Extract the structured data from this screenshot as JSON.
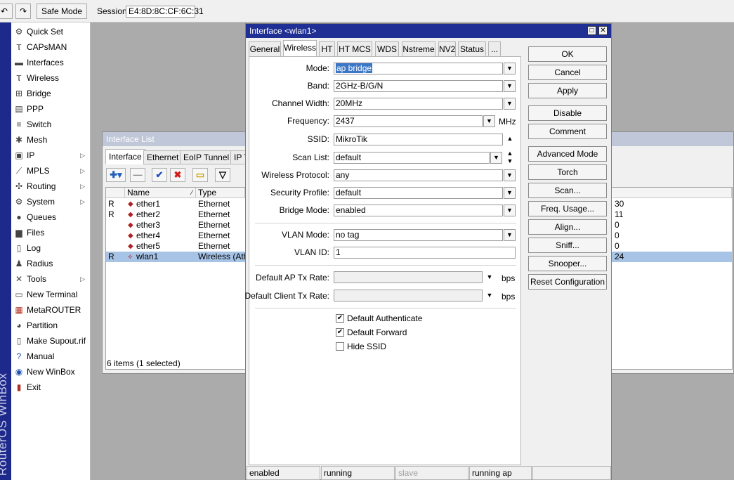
{
  "toolbar": {
    "undo_icon": "undo-icon",
    "redo_icon": "redo-icon",
    "safe_mode": "Safe Mode",
    "session_label": "Session:",
    "session_value": "E4:8D:8C:CF:6C:31"
  },
  "brand": "RouterOS WinBox",
  "sidebar": {
    "items": [
      {
        "label": "Quick Set",
        "icon": "quickset-icon",
        "submenu": false
      },
      {
        "label": "CAPsMAN",
        "icon": "antenna-icon",
        "submenu": false
      },
      {
        "label": "Interfaces",
        "icon": "interfaces-icon",
        "submenu": false
      },
      {
        "label": "Wireless",
        "icon": "antenna-icon",
        "submenu": false
      },
      {
        "label": "Bridge",
        "icon": "bridge-icon",
        "submenu": false
      },
      {
        "label": "PPP",
        "icon": "ppp-icon",
        "submenu": false
      },
      {
        "label": "Switch",
        "icon": "switch-icon",
        "submenu": false
      },
      {
        "label": "Mesh",
        "icon": "mesh-icon",
        "submenu": false
      },
      {
        "label": "IP",
        "icon": "ip-icon",
        "submenu": true
      },
      {
        "label": "MPLS",
        "icon": "mpls-icon",
        "submenu": true
      },
      {
        "label": "Routing",
        "icon": "routing-icon",
        "submenu": true
      },
      {
        "label": "System",
        "icon": "gear-icon",
        "submenu": true
      },
      {
        "label": "Queues",
        "icon": "queues-icon",
        "submenu": false
      },
      {
        "label": "Files",
        "icon": "folder-icon",
        "submenu": false
      },
      {
        "label": "Log",
        "icon": "log-icon",
        "submenu": false
      },
      {
        "label": "Radius",
        "icon": "users-icon",
        "submenu": false
      },
      {
        "label": "Tools",
        "icon": "tools-icon",
        "submenu": true
      },
      {
        "label": "New Terminal",
        "icon": "terminal-icon",
        "submenu": false
      },
      {
        "label": "MetaROUTER",
        "icon": "metarouter-icon",
        "submenu": false
      },
      {
        "label": "Partition",
        "icon": "pie-icon",
        "submenu": false
      },
      {
        "label": "Make Supout.rif",
        "icon": "document-icon",
        "submenu": false
      },
      {
        "label": "Manual",
        "icon": "help-icon",
        "submenu": false
      },
      {
        "label": "New WinBox",
        "icon": "globe-icon",
        "submenu": false
      },
      {
        "label": "Exit",
        "icon": "exit-icon",
        "submenu": false
      }
    ]
  },
  "interface_list": {
    "title": "Interface List",
    "tabs": [
      "Interface",
      "Ethernet",
      "EoIP Tunnel",
      "IP T"
    ],
    "columns": {
      "name": "Name",
      "type": "Type"
    },
    "rows": [
      {
        "flag": "R",
        "name": "ether1",
        "type": "Ethernet",
        "extra": "30",
        "selected": false
      },
      {
        "flag": "R",
        "name": "ether2",
        "type": "Ethernet",
        "extra": "11",
        "selected": false
      },
      {
        "flag": "",
        "name": "ether3",
        "type": "Ethernet",
        "extra": "0",
        "selected": false
      },
      {
        "flag": "",
        "name": "ether4",
        "type": "Ethernet",
        "extra": "0",
        "selected": false
      },
      {
        "flag": "",
        "name": "ether5",
        "type": "Ethernet",
        "extra": "0",
        "selected": false
      },
      {
        "flag": "R",
        "name": "wlan1",
        "type": "Wireless (Athe",
        "extra": "24",
        "selected": true
      }
    ],
    "status": "6 items (1 selected)"
  },
  "dialog": {
    "title": "Interface <wlan1>",
    "tabs": [
      "General",
      "Wireless",
      "HT",
      "HT MCS",
      "WDS",
      "Nstreme",
      "NV2",
      "Status",
      "..."
    ],
    "active_tab": "Wireless",
    "fields": {
      "mode": {
        "label": "Mode:",
        "value": "ap bridge"
      },
      "band": {
        "label": "Band:",
        "value": "2GHz-B/G/N"
      },
      "channel_width": {
        "label": "Channel Width:",
        "value": "20MHz"
      },
      "frequency": {
        "label": "Frequency:",
        "value": "2437",
        "unit": "MHz"
      },
      "ssid": {
        "label": "SSID:",
        "value": "MikroTik"
      },
      "scan_list": {
        "label": "Scan List:",
        "value": "default"
      },
      "wireless_protocol": {
        "label": "Wireless Protocol:",
        "value": "any"
      },
      "security_profile": {
        "label": "Security Profile:",
        "value": "default"
      },
      "bridge_mode": {
        "label": "Bridge Mode:",
        "value": "enabled"
      },
      "vlan_mode": {
        "label": "VLAN Mode:",
        "value": "no tag"
      },
      "vlan_id": {
        "label": "VLAN ID:",
        "value": "1"
      },
      "default_ap_tx_rate": {
        "label": "Default AP Tx Rate:",
        "value": "",
        "unit": "bps"
      },
      "default_client_tx_rate": {
        "label": "Default Client Tx Rate:",
        "value": "",
        "unit": "bps"
      }
    },
    "checkboxes": [
      {
        "label": "Default Authenticate",
        "checked": true
      },
      {
        "label": "Default Forward",
        "checked": true
      },
      {
        "label": "Hide SSID",
        "checked": false
      }
    ],
    "buttons": [
      "OK",
      "Cancel",
      "Apply",
      "Disable",
      "Comment",
      "Advanced Mode",
      "Torch",
      "Scan...",
      "Freq. Usage...",
      "Align...",
      "Sniff...",
      "Snooper...",
      "Reset Configuration"
    ],
    "status_bar": [
      "enabled",
      "running",
      "slave",
      "running ap",
      ""
    ]
  },
  "colors": {
    "title_active": "#1f2f94",
    "title_inactive": "#bfc7d8",
    "selection": "#a7c3e6",
    "strip": "#1d2a8c"
  }
}
